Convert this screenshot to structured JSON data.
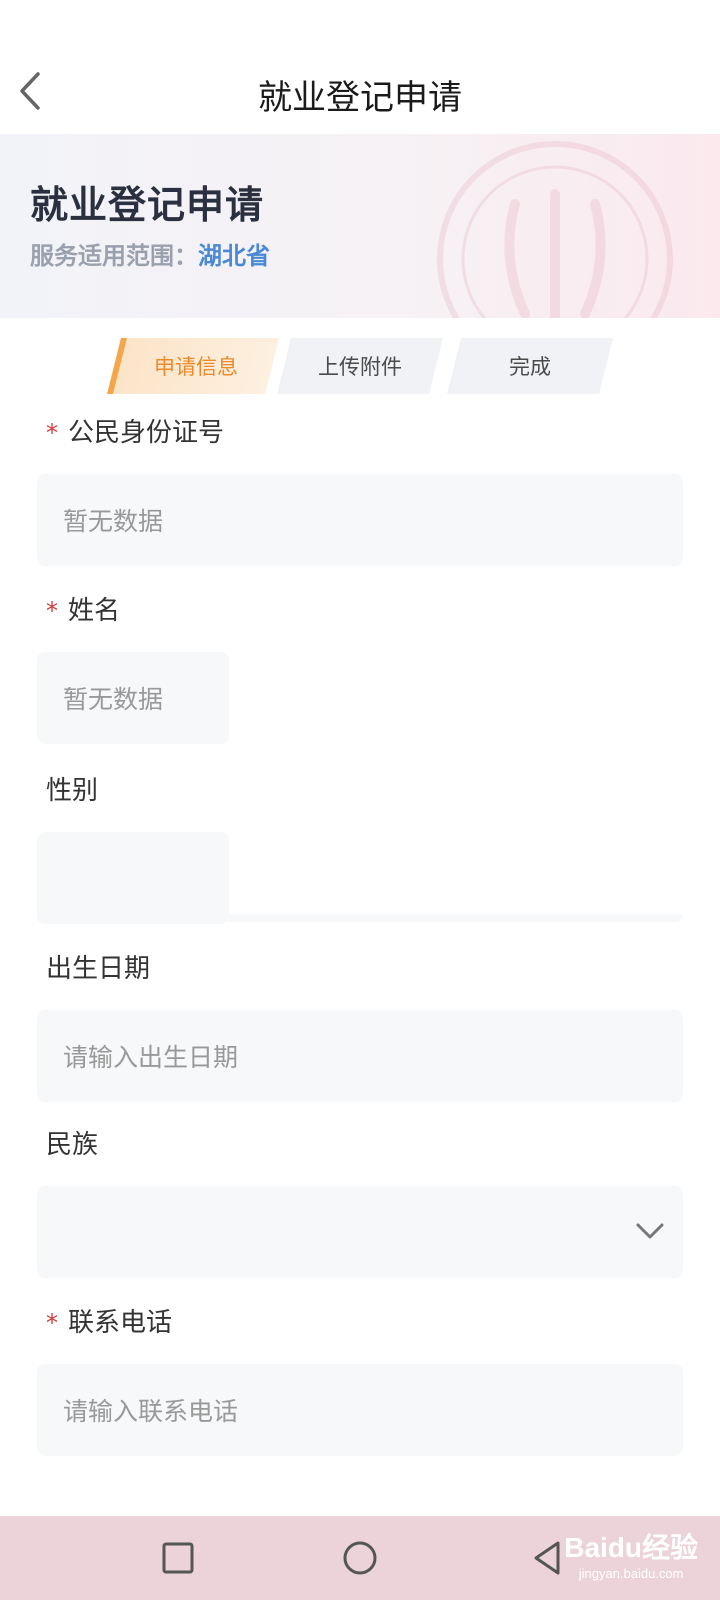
{
  "header": {
    "title": "就业登记申请",
    "back_icon": "chevron-left-icon"
  },
  "hero": {
    "title": "就业登记申请",
    "scope_label": "服务适用范围：",
    "scope_value": "湖北省",
    "emblem_icon": "emblem-icon"
  },
  "steps": [
    {
      "label": "申请信息",
      "active": true
    },
    {
      "label": "上传附件",
      "active": false
    },
    {
      "label": "完成",
      "active": false
    }
  ],
  "form": {
    "id_number": {
      "label": "公民身份证号",
      "required": true,
      "value": "暂无数据"
    },
    "name": {
      "label": "姓名",
      "required": true,
      "value": "暂无数据"
    },
    "gender": {
      "label": "性别",
      "required": false,
      "value": ""
    },
    "birth_date": {
      "label": "出生日期",
      "required": false,
      "placeholder": "请输入出生日期"
    },
    "ethnicity": {
      "label": "民族",
      "required": false,
      "value": "",
      "icon": "chevron-down-icon"
    },
    "phone": {
      "label": "联系电话",
      "required": true,
      "placeholder": "请输入联系电话"
    },
    "required_mark": "*"
  },
  "system_nav": {
    "icons": [
      "square-recent-icon",
      "circle-home-icon",
      "triangle-back-icon"
    ]
  },
  "watermark": {
    "main": "Baidu经验",
    "sub": "jingyan.baidu.com"
  },
  "colors": {
    "accent_orange": "#ea8a2c",
    "scope_blue": "#4a89d6",
    "required_red": "#d63b3b",
    "field_bg": "#f7f8fa",
    "sysbar_bg": "#ecd3d9"
  }
}
